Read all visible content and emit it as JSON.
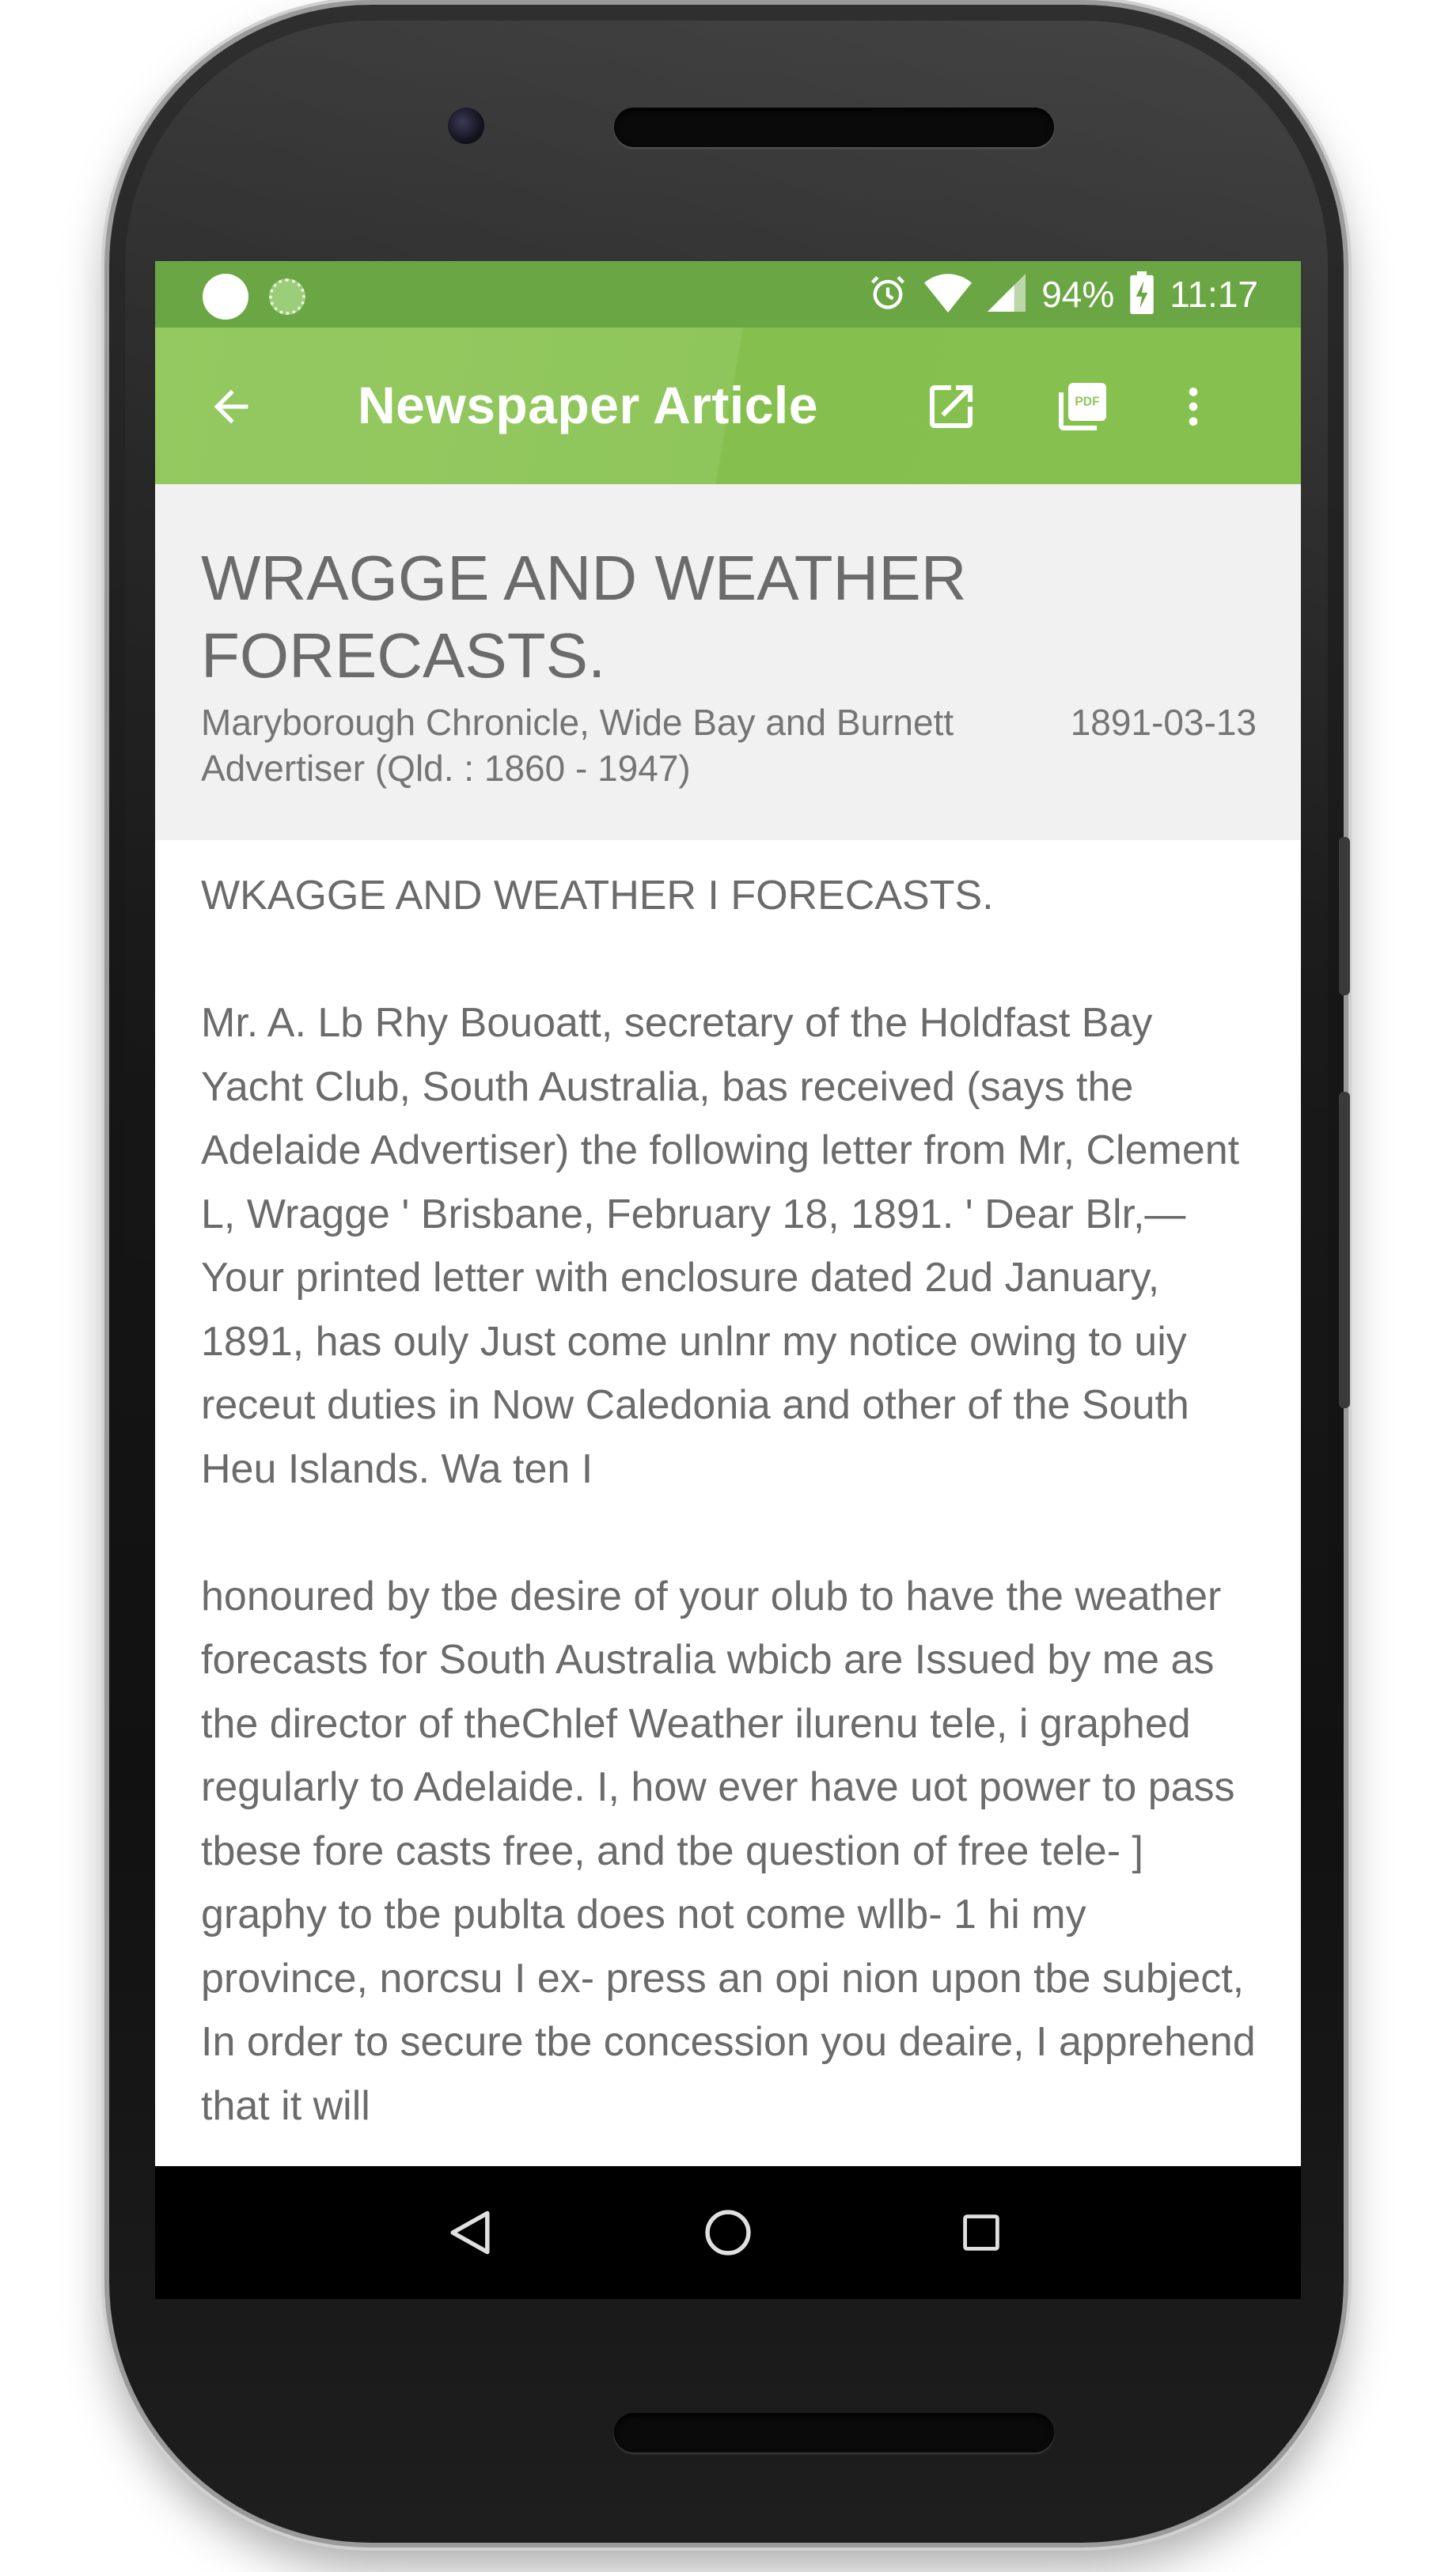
{
  "status_bar": {
    "battery": "94%",
    "time": "11:17",
    "icons": [
      "alarm-icon",
      "wifi-icon",
      "signal-icon",
      "battery-charging-icon"
    ]
  },
  "app_bar": {
    "title": "Newspaper Article",
    "back_icon": "arrow-back-icon",
    "actions": [
      "open-in-new-icon",
      "pdf-icon",
      "more-vert-icon"
    ]
  },
  "article": {
    "title": "WRAGGE AND WEATHER FORECASTS.",
    "source": "Maryborough Chronicle, Wide Bay and Burnett Advertiser (Qld. : 1860 - 1947)",
    "date": "1891-03-13",
    "paragraphs": [
      "WKAGGE AND WEATHER I FORECASTS.",
      "Mr. A. Lb Rhy Bouoatt, secretary of the Holdfast Bay Yacht Club, South Australia, bas received (says the Adelaide Advertiser) the following letter from Mr, Clement L, Wragge ' Brisbane, February 18, 1891. ' Dear Blr,— Your printed letter with enclosure dated 2ud January, 1891, has ouly Just come unlnr my notice owing to uiy receut duties in Now Caledonia and other of the South Heu Islands. Wa ten I",
      "honoured by tbe desire of your olub to have the weather forecasts for South Australia wbicb are Issued by me as the director of theChlef Weather ilurenu tele, i graphed regularly to Adelaide. I, how ever have uot power to pass tbese fore casts free, and tbe question of free tele- ] graphy to tbe publta does not come wllb- 1 hi my province, norcsu I ex- press an opi nion upon tbe subject, In order to secure tbe concession you deaire, I apprehend that it will"
    ]
  },
  "nav_bar": {
    "buttons": [
      "nav-back-icon",
      "nav-home-icon",
      "nav-recents-icon"
    ]
  },
  "colors": {
    "status_bar": "#6aa643",
    "app_bar": "#8fc65b",
    "header_card": "#f1f1f1",
    "text": "#6b6b6b"
  }
}
